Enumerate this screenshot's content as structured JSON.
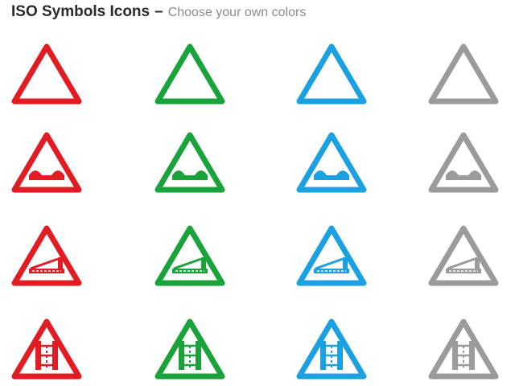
{
  "header": {
    "title": "ISO Symbols Icons",
    "dash": "–",
    "subtitle": "Choose your own colors"
  },
  "colors": [
    "#e31b23",
    "#1aa33a",
    "#1ba1e2",
    "#9b9b9b"
  ],
  "rows": [
    {
      "icon": "road-narrows-icon"
    },
    {
      "icon": "speed-bump-icon"
    },
    {
      "icon": "level-crossing-barrier-icon"
    },
    {
      "icon": "bridge-icon"
    }
  ]
}
